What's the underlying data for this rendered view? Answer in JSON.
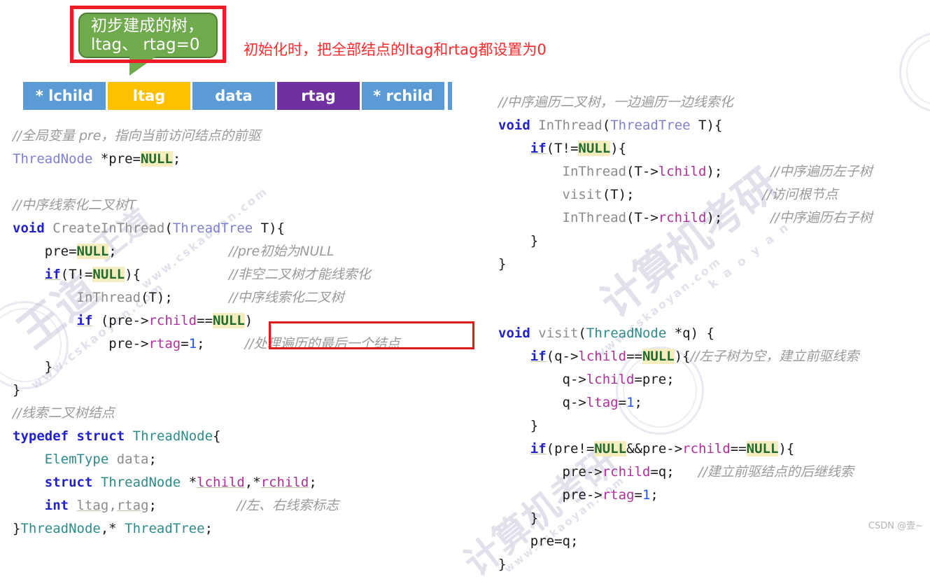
{
  "callout": {
    "line1": "初步建成的树，",
    "line2": "ltag、 rtag=0",
    "green_color": "#6faa4c",
    "border_color": "#ee1c24"
  },
  "top_note": {
    "text": "初始化时，把全部结点的ltag和rtag都设置为0",
    "color": "#fd2b2b"
  },
  "node_table": {
    "cells": [
      {
        "label": "* lchild",
        "color": "#5b9bd5",
        "width": 118
      },
      {
        "label": "ltag",
        "color": "#ffc000",
        "width": 118
      },
      {
        "label": "data",
        "color": "#5b9bd5",
        "width": 118
      },
      {
        "label": "rtag",
        "color": "#7030a0",
        "width": 118
      },
      {
        "label": "* rchild",
        "color": "#5b9bd5",
        "width": 118
      }
    ]
  },
  "code_left": {
    "title": "CreateInThread",
    "lines": [
      "//全局变量 pre，指向当前访问结点的前驱",
      "ThreadNode *pre=NULL;",
      "",
      "//中序线索化二叉树T",
      "void CreateInThread(ThreadTree T){",
      "    pre=NULL;                //pre初始为NULL",
      "    if(T!=NULL){             //非空二叉树才能线索化",
      "        InThread(T);         //中序线索化二叉树",
      "        if (pre->rchild==NULL)",
      "            pre->rtag=1;     //处理遍历的最后一个结点",
      "    }",
      "}",
      "//线索二叉树结点",
      "typedef struct ThreadNode{",
      "    ElemType data;",
      "    struct ThreadNode *lchild,*rchild;",
      "    int ltag,rtag;           //左、右线索标志",
      "}ThreadNode,* ThreadTree;"
    ],
    "boxed_comment": "//处理遍历的最后一个结点"
  },
  "code_right": {
    "title": "InThread / visit",
    "lines": [
      "//中序遍历二叉树，一边遍历一边线索化",
      "void InThread(ThreadTree T){",
      "    if(T!=NULL){",
      "        InThread(T->lchild);      //中序遍历左子树",
      "        visit(T);                 //访问根节点",
      "        InThread(T->rchild);      //中序遍历右子树",
      "    }",
      "}",
      "",
      "void visit(ThreadNode *q) {",
      "    if(q->lchild==NULL){//左子树为空，建立前驱线索",
      "        q->lchild=pre;",
      "        q->ltag=1;",
      "    }",
      "    if(pre!=NULL&&pre->rchild==NULL){",
      "        pre->rchild=q;   //建立前驱结点的后继线索",
      "        pre->rtag=1;",
      "    }",
      "    pre=q;",
      "}"
    ]
  },
  "watermarks": {
    "brand_1": "王道",
    "brand_2": "计算机考研",
    "url": "www.cskaoyan.com",
    "url_2": "k a o y a n"
  },
  "footer": {
    "csdn": "CSDN @壹~"
  }
}
